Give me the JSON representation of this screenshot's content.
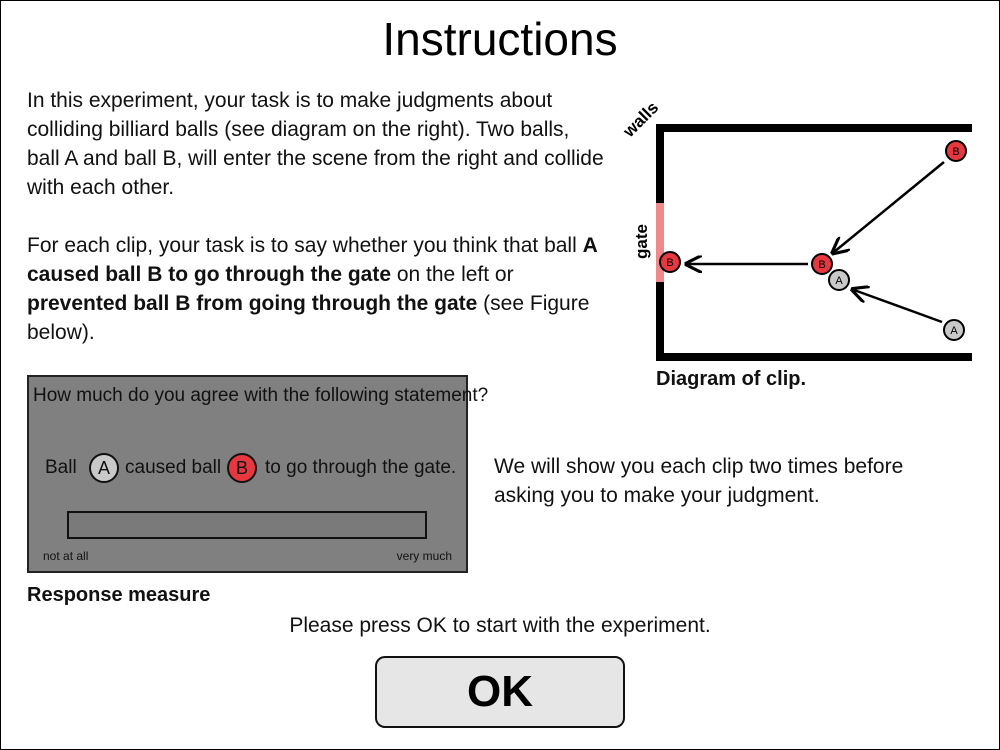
{
  "page": {
    "title": "Instructions"
  },
  "intro": {
    "p1": "In this experiment, your task is to make judgments about colliding billiard balls (see diagram on the right). Two balls, ball A and ball B, will enter the scene from the right and collide with each other.",
    "p2_part1": "For each clip, your task is to say whether you think that ball ",
    "p2_bold1": "A caused ball B to go through the gate",
    "p2_part2": " on the left or ",
    "p2_bold2": "prevented ball B from going through the gate",
    "p2_part3": " (see Figure below)."
  },
  "diagram": {
    "walls_label": "walls",
    "gate_label": "gate",
    "ball_a_label": "A",
    "ball_b_label": "B",
    "caption": "Diagram of clip.",
    "colors": {
      "ball_a": "#c9c9c9",
      "ball_b": "#e8383f",
      "gate": "#f08a8a",
      "walls": "#000000"
    }
  },
  "response": {
    "question": "How much do you agree with the following statement?",
    "word_ball": "Ball",
    "ball_a": "A",
    "word_caused": "caused ball",
    "ball_b": "B",
    "word_gate": "to go through the gate.",
    "min_label": "not at all",
    "max_label": "very much",
    "caption": "Response measure"
  },
  "show_note": "We will show you each clip two times before asking you to make your judgment.",
  "prompt": "Please press OK to start with the experiment.",
  "ok_label": "OK"
}
